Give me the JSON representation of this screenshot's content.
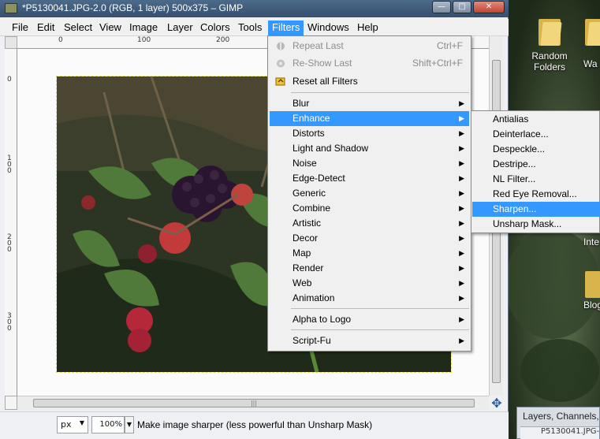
{
  "window": {
    "title": "*P5130041.JPG-2.0 (RGB, 1 layer) 500x375 – GIMP",
    "minimize_icon": "minimize-icon",
    "maximize_icon": "maximize-icon",
    "close_icon": "close-icon"
  },
  "menubar": {
    "items": [
      "File",
      "Edit",
      "Select",
      "View",
      "Image",
      "Layer",
      "Colors",
      "Tools",
      "Filters",
      "Windows",
      "Help"
    ],
    "active": "Filters"
  },
  "ruler": {
    "h_labels": [
      "0",
      "100",
      "200"
    ],
    "v_labels": [
      "0",
      "100",
      "200",
      "300"
    ]
  },
  "filters_menu": {
    "items": [
      {
        "label": "Repeat Last",
        "shortcut": "Ctrl+F",
        "disabled": true,
        "icon": "repeat-icon"
      },
      {
        "label": "Re-Show Last",
        "shortcut": "Shift+Ctrl+F",
        "disabled": true,
        "icon": "reshow-icon"
      },
      {
        "label": "Reset all Filters",
        "icon": "reset-icon"
      },
      {
        "label": "Blur",
        "submenu": true
      },
      {
        "label": "Enhance",
        "submenu": true,
        "highlighted": true
      },
      {
        "label": "Distorts",
        "submenu": true
      },
      {
        "label": "Light and Shadow",
        "submenu": true
      },
      {
        "label": "Noise",
        "submenu": true
      },
      {
        "label": "Edge-Detect",
        "submenu": true
      },
      {
        "label": "Generic",
        "submenu": true
      },
      {
        "label": "Combine",
        "submenu": true
      },
      {
        "label": "Artistic",
        "submenu": true
      },
      {
        "label": "Decor",
        "submenu": true
      },
      {
        "label": "Map",
        "submenu": true
      },
      {
        "label": "Render",
        "submenu": true
      },
      {
        "label": "Web",
        "submenu": true
      },
      {
        "label": "Animation",
        "submenu": true
      },
      {
        "label": "Alpha to Logo",
        "submenu": true
      },
      {
        "label": "Script-Fu",
        "submenu": true
      }
    ]
  },
  "enhance_menu": {
    "items": [
      {
        "label": "Antialias"
      },
      {
        "label": "Deinterlace..."
      },
      {
        "label": "Despeckle..."
      },
      {
        "label": "Destripe..."
      },
      {
        "label": "NL Filter..."
      },
      {
        "label": "Red Eye Removal..."
      },
      {
        "label": "Sharpen...",
        "highlighted": true
      },
      {
        "label": "Unsharp Mask..."
      }
    ]
  },
  "statusbar": {
    "unit": "px",
    "zoom": "100%",
    "message": "Make image sharper (less powerful than Unsharp Mask)"
  },
  "desktop": {
    "icons": [
      {
        "label": "Random Folders"
      },
      {
        "label": "Wa"
      },
      {
        "label": "Inte"
      },
      {
        "label": "Blog"
      }
    ]
  },
  "layers_dock": {
    "title": "Layers, Channels, P",
    "sub": "P5130041.JPG-2"
  },
  "colors": {
    "highlight": "#3399ff",
    "titlebar": "#3f5c7b"
  }
}
